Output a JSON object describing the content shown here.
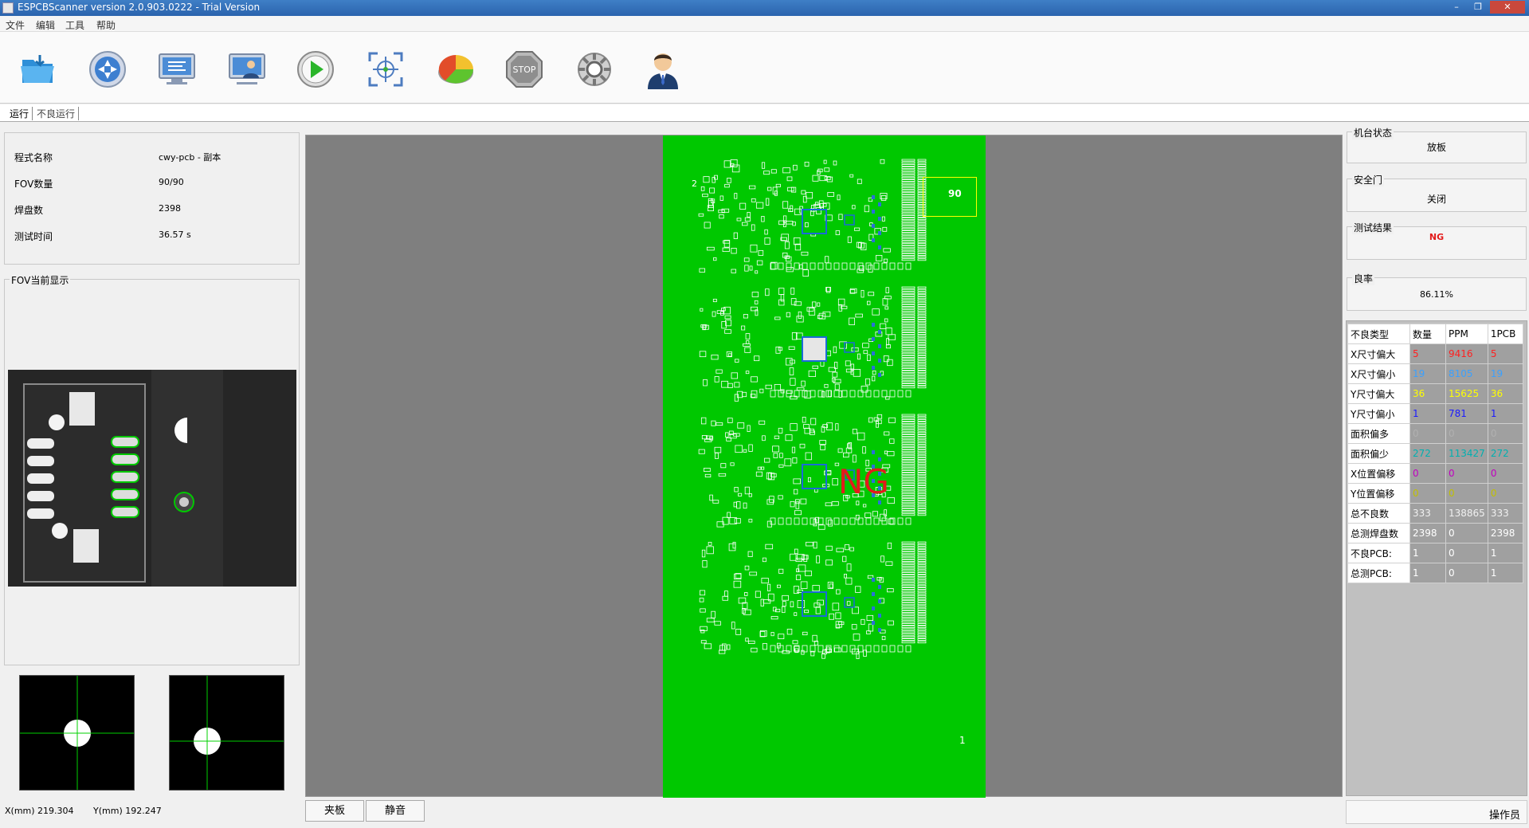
{
  "window": {
    "title": "ESPCBScanner version 2.0.903.0222 - Trial Version",
    "controls": [
      "–",
      "❐",
      "✕"
    ]
  },
  "menu": [
    "文件",
    "编辑",
    "工具",
    "帮助"
  ],
  "toolbar": {
    "icons": [
      "open-folder-icon",
      "navigate-icon",
      "monitor-code-icon",
      "monitor-user-icon",
      "play-icon",
      "fiducial-target-icon",
      "pie-chart-icon",
      "stop-icon",
      "gear-icon",
      "operator-icon"
    ],
    "stop_label": "STOP"
  },
  "tabs": [
    "运行",
    "不良运行"
  ],
  "program_info": {
    "rows": [
      {
        "label": "程式名称",
        "value": "cwy-pcb - 副本"
      },
      {
        "label": "FOV数量",
        "value": "90/90"
      },
      {
        "label": "焊盘数",
        "value": "2398"
      },
      {
        "label": "测试时间",
        "value": "36.57 s"
      }
    ]
  },
  "fov_panel": {
    "title": "FOV当前显示"
  },
  "pcb_view": {
    "result_overlay": "NG",
    "fov_number_top": "90",
    "fov_number_bottom": "1",
    "corner_label": "2",
    "board_color": "#00c800",
    "canvas_color": "#7f7f7f"
  },
  "status_bar": {
    "x_coord": "X(mm) 219.304",
    "y_coord": "Y(mm) 192.247",
    "btn_clamp": "夹板",
    "btn_mute": "静音",
    "operator": "操作员"
  },
  "machine_status": {
    "machine_state_label": "机台状态",
    "machine_state_value": "放板",
    "safety_door_label": "安全门",
    "safety_door_value": "关闭",
    "test_result_label": "测试结果",
    "test_result_value": "NG",
    "test_result_color": "#e31b1b",
    "yield_label": "良率",
    "yield_value": "86.11%"
  },
  "defect_table": {
    "headers": [
      "不良类型",
      "数量",
      "PPM",
      "1PCB"
    ],
    "rows": [
      {
        "name": "X尺寸偏大",
        "count": "5",
        "ppm": "9416",
        "pcb": "5",
        "color": "#ff2020"
      },
      {
        "name": "X尺寸偏小",
        "count": "19",
        "ppm": "8105",
        "pcb": "19",
        "color": "#3aa0ff"
      },
      {
        "name": "Y尺寸偏大",
        "count": "36",
        "ppm": "15625",
        "pcb": "36",
        "color": "#ffff00"
      },
      {
        "name": "Y尺寸偏小",
        "count": "1",
        "ppm": "781",
        "pcb": "1",
        "color": "#1a1aff"
      },
      {
        "name": "面积偏多",
        "count": "0",
        "ppm": "0",
        "pcb": "0",
        "color": "#b0b0b0"
      },
      {
        "name": "面积偏少",
        "count": "272",
        "ppm": "113427",
        "pcb": "272",
        "color": "#00b0b0"
      },
      {
        "name": "X位置偏移",
        "count": "0",
        "ppm": "0",
        "pcb": "0",
        "color": "#c000c0"
      },
      {
        "name": "Y位置偏移",
        "count": "0",
        "ppm": "0",
        "pcb": "0",
        "color": "#c0c000"
      },
      {
        "name": "总不良数",
        "count": "333",
        "ppm": "138865",
        "pcb": "333",
        "color": "#f0f0f0"
      },
      {
        "name": "总测焊盘数",
        "count": "2398",
        "ppm": "0",
        "pcb": "2398",
        "color": "#ffffff"
      },
      {
        "name": "不良PCB:",
        "count": "1",
        "ppm": "0",
        "pcb": "1",
        "color": "#ffffff"
      },
      {
        "name": "总测PCB:",
        "count": "1",
        "ppm": "0",
        "pcb": "1",
        "color": "#ffffff"
      }
    ]
  }
}
